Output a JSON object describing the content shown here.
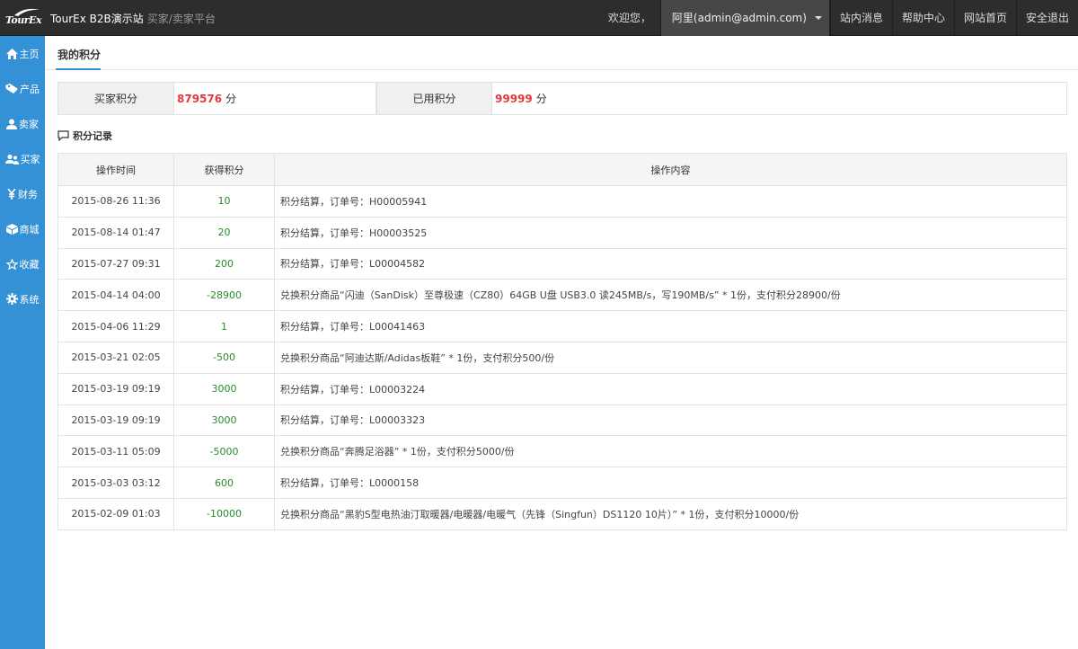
{
  "header": {
    "logo_text": "TourEx",
    "site_title": "TourEx B2B演示站",
    "site_subtitle": "买家/卖家平台",
    "welcome": "欢迎您，",
    "user": "阿里(admin@admin.com)",
    "links": [
      "站内消息",
      "帮助中心",
      "网站首页",
      "安全退出"
    ]
  },
  "sidebar": {
    "items": [
      {
        "label": "主页",
        "icon": "home-icon"
      },
      {
        "label": "产品",
        "icon": "tag-icon"
      },
      {
        "label": "卖家",
        "icon": "user-icon"
      },
      {
        "label": "买家",
        "icon": "users-icon"
      },
      {
        "label": "财务",
        "icon": "yen-icon"
      },
      {
        "label": "商城",
        "icon": "box-icon"
      },
      {
        "label": "收藏",
        "icon": "star-icon"
      },
      {
        "label": "系统",
        "icon": "gear-icon"
      }
    ]
  },
  "page": {
    "title": "我的积分",
    "summary": {
      "buyer_label": "买家积分",
      "buyer_value": "879576",
      "used_label": "已用积分",
      "used_value": "99999",
      "unit": "分"
    },
    "section_title": "积分记录",
    "table": {
      "headers": [
        "操作时间",
        "获得积分",
        "操作内容"
      ],
      "rows": [
        {
          "time": "2015-08-26 11:36",
          "points": "10",
          "desc": "积分结算，订单号：H00005941"
        },
        {
          "time": "2015-08-14 01:47",
          "points": "20",
          "desc": "积分结算，订单号：H00003525"
        },
        {
          "time": "2015-07-27 09:31",
          "points": "200",
          "desc": "积分结算，订单号：L00004582"
        },
        {
          "time": "2015-04-14 04:00",
          "points": "-28900",
          "desc": "兑换积分商品“闪迪（SanDisk）至尊极速（CZ80）64GB U盘 USB3.0 读245MB/s，写190MB/s” * 1份，支付积分28900/份"
        },
        {
          "time": "2015-04-06 11:29",
          "points": "1",
          "desc": "积分结算，订单号：L00041463"
        },
        {
          "time": "2015-03-21 02:05",
          "points": "-500",
          "desc": "兑换积分商品“阿迪达斯/Adidas板鞋” * 1份，支付积分500/份"
        },
        {
          "time": "2015-03-19 09:19",
          "points": "3000",
          "desc": "积分结算，订单号：L00003224"
        },
        {
          "time": "2015-03-19 09:19",
          "points": "3000",
          "desc": "积分结算，订单号：L00003323"
        },
        {
          "time": "2015-03-11 05:09",
          "points": "-5000",
          "desc": "兑换积分商品“奔腾足浴器” * 1份，支付积分5000/份"
        },
        {
          "time": "2015-03-03 03:12",
          "points": "600",
          "desc": "积分结算，订单号：L0000158"
        },
        {
          "time": "2015-02-09 01:03",
          "points": "-10000",
          "desc": "兑换积分商品“黑豹S型电热油汀取暖器/电暖器/电暖气（先锋（Singfun）DS1120 10片）” * 1份，支付积分10000/份"
        }
      ]
    }
  },
  "colors": {
    "sidebar": "#3591d5",
    "topbar": "#2d2d2d",
    "red": "#e4393c",
    "green": "#2a8a2a"
  }
}
